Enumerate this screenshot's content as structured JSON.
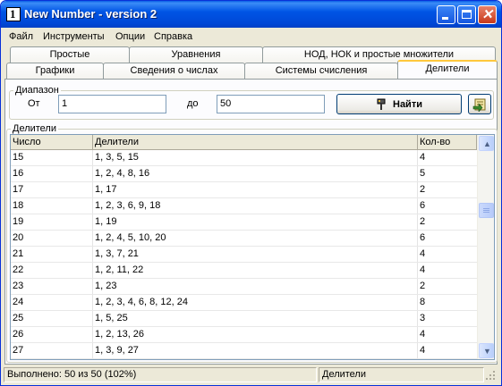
{
  "window": {
    "title": "New Number - version 2",
    "icon_glyph": "1",
    "icons": {
      "app": "app-icon",
      "minimize": "minimize-icon",
      "maximize": "maximize-icon",
      "close": "close-icon"
    }
  },
  "menu": [
    "Файл",
    "Инструменты",
    "Опции",
    "Справка"
  ],
  "tabs": {
    "row_back": [
      "Простые",
      "Уравнения",
      "НОД, НОК и простые множители"
    ],
    "row_front": [
      "Графики",
      "Сведения о числах",
      "Системы счисления",
      "Делители"
    ],
    "active": "Делители"
  },
  "range": {
    "group_label": "Диапазон",
    "from_label": "От",
    "from_value": "1",
    "to_label": "до",
    "to_value": "50",
    "find_button": "Найти",
    "find_icon": "tool-icon",
    "export_icon": "export-icon"
  },
  "results": {
    "group_label": "Делители",
    "columns": [
      "Число",
      "Делители",
      "Кол-во"
    ],
    "rows": [
      [
        "15",
        "1, 3, 5, 15",
        "4"
      ],
      [
        "16",
        "1, 2, 4, 8, 16",
        "5"
      ],
      [
        "17",
        "1, 17",
        "2"
      ],
      [
        "18",
        "1, 2, 3, 6, 9, 18",
        "6"
      ],
      [
        "19",
        "1, 19",
        "2"
      ],
      [
        "20",
        "1, 2, 4, 5, 10, 20",
        "6"
      ],
      [
        "21",
        "1, 3, 7, 21",
        "4"
      ],
      [
        "22",
        "1, 2, 11, 22",
        "4"
      ],
      [
        "23",
        "1, 23",
        "2"
      ],
      [
        "24",
        "1, 2, 3, 4, 6, 8, 12, 24",
        "8"
      ],
      [
        "25",
        "1, 5, 25",
        "3"
      ],
      [
        "26",
        "1, 2, 13, 26",
        "4"
      ],
      [
        "27",
        "1, 3, 9, 27",
        "4"
      ],
      [
        "28",
        "1, 2, 4, 7, 14, 28",
        "6"
      ]
    ],
    "scroll_position": 0.29
  },
  "status": {
    "left": "Выполнено: 50 из 50 (102%)",
    "right": "Делители"
  },
  "colors": {
    "title_bar": "#0055e5",
    "active_tab_accent": "#ffc83c",
    "close_button": "#c8391a"
  }
}
